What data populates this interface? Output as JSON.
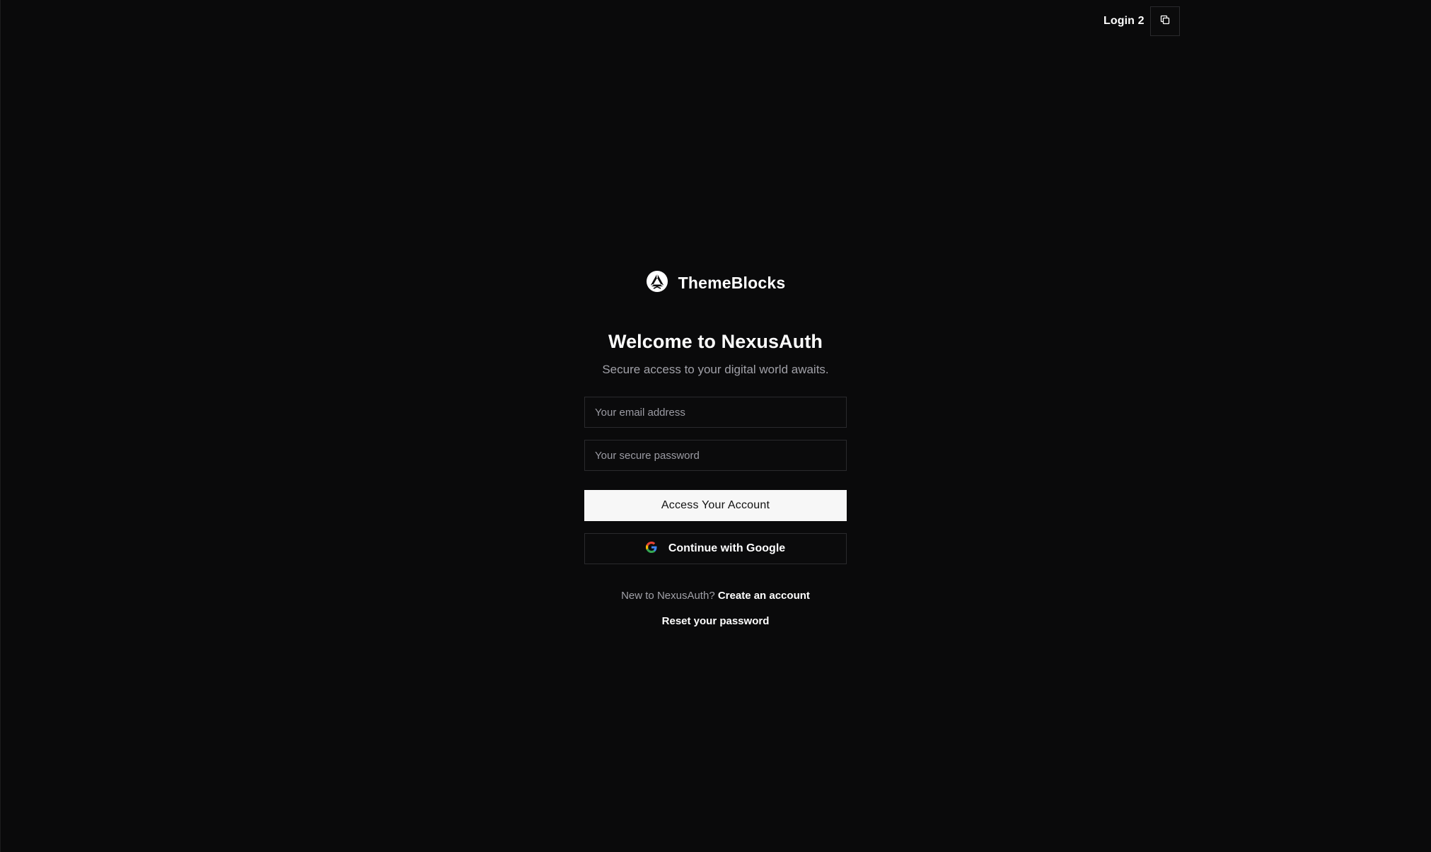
{
  "header": {
    "title": "Login 2",
    "copy_icon": "copy-icon"
  },
  "brand": {
    "name": "ThemeBlocks",
    "logo_icon": "triangle-logo-icon"
  },
  "form": {
    "title": "Welcome to NexusAuth",
    "subtitle": "Secure access to your digital world awaits.",
    "email_placeholder": "Your email address",
    "email_value": "",
    "password_placeholder": "Your secure password",
    "password_value": "",
    "submit_label": "Access Your Account",
    "google_label": "Continue with Google",
    "google_icon": "google-icon"
  },
  "footer": {
    "signup_prompt": "New to NexusAuth?",
    "signup_link": "Create an account",
    "reset_link": "Reset your password"
  },
  "colors": {
    "background": "#0a0a0b",
    "border": "#2a2a2d",
    "muted_text": "#a1a1a8",
    "primary_button": "#f7f7f7"
  }
}
